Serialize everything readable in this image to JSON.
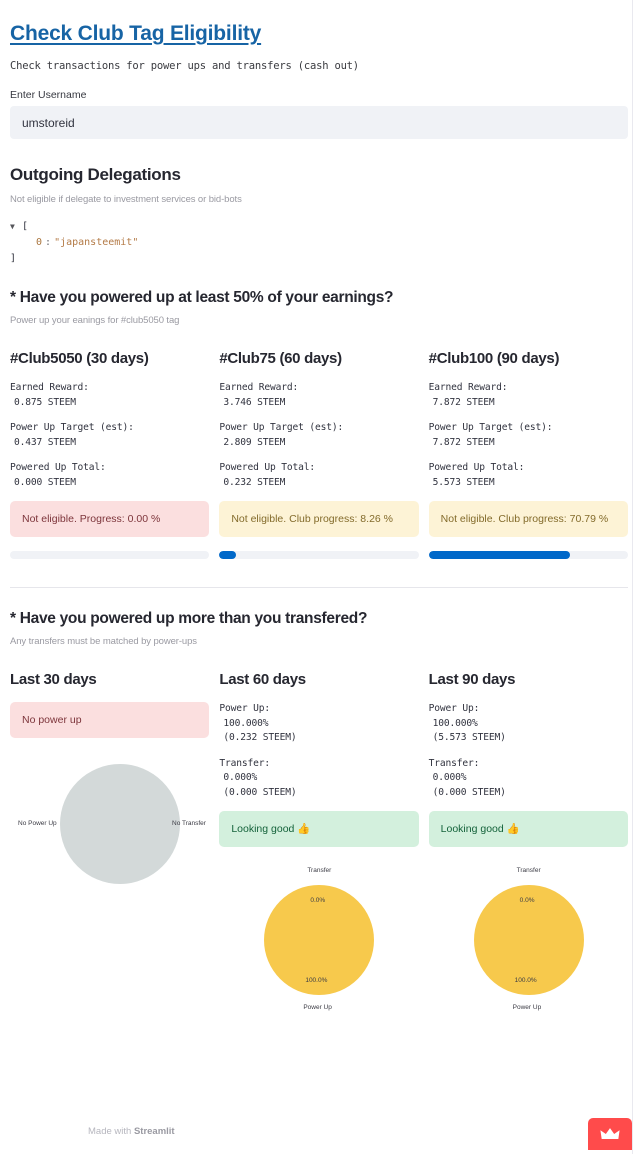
{
  "app": {
    "title": "Check Club Tag Eligibility",
    "subtitle": "Check transactions for power ups and transfers (cash out)"
  },
  "username_field": {
    "label": "Enter Username",
    "value": "umstoreid",
    "placeholder": "Enter Username"
  },
  "delegations": {
    "heading": "Outgoing Delegations",
    "caption": "Not eligible if delegate to investment services or bid-bots",
    "open_bracket": "[",
    "close_bracket": "]",
    "items": [
      {
        "index": "0",
        "colon": ":",
        "value": "\"japansteemit\""
      }
    ]
  },
  "question_powerup": {
    "heading": "* Have you powered up at least 50% of your earnings?",
    "caption": "Power up your eanings for #club5050 tag",
    "labels": {
      "earned": "Earned Reward:",
      "target": "Power Up Target (est):",
      "powered": "Powered Up Total:"
    },
    "clubs": [
      {
        "title": "#Club5050 (30 days)",
        "earned": "0.875 STEEM",
        "target": "0.437 STEEM",
        "powered": "0.000 STEEM",
        "status": "Not eligible. Progress: 0.00 %",
        "status_type": "error",
        "progress_pct": 0
      },
      {
        "title": "#Club75 (60 days)",
        "earned": "3.746 STEEM",
        "target": "2.809 STEEM",
        "powered": "0.232 STEEM",
        "status": "Not eligible. Club progress: 8.26 %",
        "status_type": "warn",
        "progress_pct": 8.26
      },
      {
        "title": "#Club100 (90 days)",
        "earned": "7.872 STEEM",
        "target": "7.872 STEEM",
        "powered": "5.573 STEEM",
        "status": "Not eligible. Club progress: 70.79 %",
        "status_type": "warn",
        "progress_pct": 70.79
      }
    ]
  },
  "question_transfer": {
    "heading": "* Have you powered up more than you transfered?",
    "caption": "Any transfers must be matched by power-ups",
    "labels": {
      "powerup": "Power Up:",
      "transfer": "Transfer:"
    },
    "periods": [
      {
        "title": "Last 30 days",
        "status": "No power up",
        "status_type": "error",
        "has_stats": false
      },
      {
        "title": "Last 60 days",
        "powerup_pct": "100.000%",
        "powerup_amount": "(0.232 STEEM)",
        "transfer_pct": "0.000%",
        "transfer_amount": "(0.000 STEEM)",
        "status": "Looking good 👍",
        "status_type": "success",
        "has_stats": true
      },
      {
        "title": "Last 90 days",
        "powerup_pct": "100.000%",
        "powerup_amount": "(5.573 STEEM)",
        "transfer_pct": "0.000%",
        "transfer_amount": "(0.000 STEEM)",
        "status": "Looking good 👍",
        "status_type": "success",
        "has_stats": true
      }
    ]
  },
  "chart_data": [
    {
      "type": "pie",
      "title": "Last 30 days power up vs transfer",
      "labels": [
        "No Power Up",
        "No Transfer"
      ],
      "values": [
        0,
        0
      ],
      "data_labels": [
        "",
        ""
      ],
      "colors": [
        "#d3d9d9",
        "#d3d9d9"
      ],
      "empty": true,
      "label_positions": [
        "left",
        "right"
      ]
    },
    {
      "type": "pie",
      "title": "Last 60 days power up vs transfer",
      "labels": [
        "Transfer",
        "Power Up"
      ],
      "values": [
        0.0,
        100.0
      ],
      "data_labels": [
        "0.0%",
        "100.0%"
      ],
      "colors": [
        "#f7c94c",
        "#f7c94c"
      ],
      "empty": false,
      "label_positions": [
        "top",
        "bottom"
      ]
    },
    {
      "type": "pie",
      "title": "Last 90 days power up vs transfer",
      "labels": [
        "Transfer",
        "Power Up"
      ],
      "values": [
        0.0,
        100.0
      ],
      "data_labels": [
        "0.0%",
        "100.0%"
      ],
      "colors": [
        "#f7c94c",
        "#f7c94c"
      ],
      "empty": false,
      "label_positions": [
        "top",
        "bottom"
      ]
    }
  ],
  "footer": {
    "made_with": "Made with ",
    "brand": "Streamlit",
    "badge_icon": "crown-icon"
  },
  "colors": {
    "accent": "#1764a5",
    "progress": "#0068c9",
    "pie_amber": "#f7c94c",
    "pie_gray": "#d3d9d9",
    "badge_red": "#ff4b4b"
  }
}
